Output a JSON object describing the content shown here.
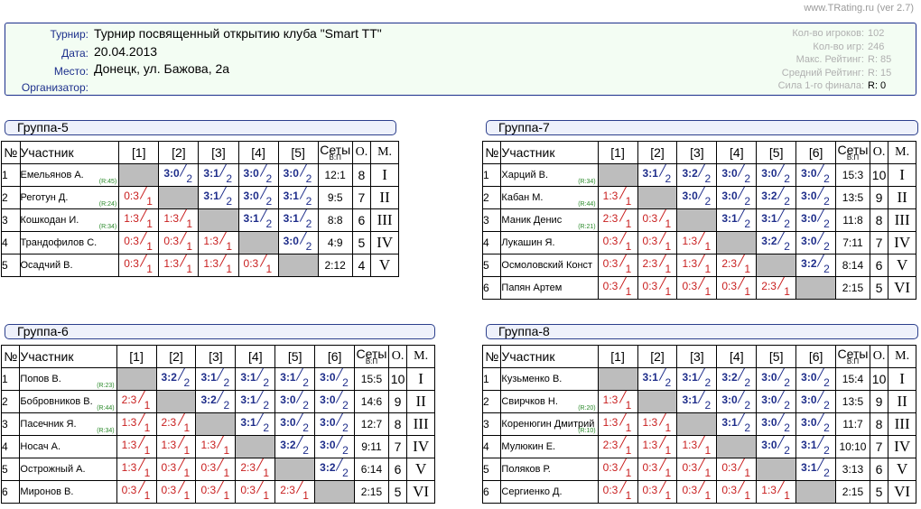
{
  "version": "www.TRating.ru (ver 2.7)",
  "tournament": {
    "labels": {
      "name": "Турнир:",
      "date": "Дата:",
      "place": "Место:",
      "organizer": "Организатор:"
    },
    "name": "Турнир посвященный открытию клуба \"Smart TT\"",
    "date": "20.04.2013",
    "place": "Донецк, ул. Бажова, 2а",
    "organizer": ""
  },
  "stats": [
    {
      "label": "Кол-во игроков:",
      "value": "102",
      "dark": false
    },
    {
      "label": "Кол-во игр:",
      "value": "246",
      "dark": false
    },
    {
      "label": "Макс. Рейтинг:",
      "value": "R:  85",
      "dark": false
    },
    {
      "label": "Средний Рейтинг:",
      "value": "R:  15",
      "dark": false
    },
    {
      "label": "Сила 1-го финала:",
      "value": "R:   0",
      "dark": true
    }
  ],
  "headers": {
    "num": "№",
    "player": "Участник",
    "sets": "Сеты",
    "sets_sub": "В:П",
    "points": "О.",
    "place": "М."
  },
  "groups": [
    {
      "title": "Группа-5",
      "players": [
        {
          "num": "1",
          "name": "Емельянов А.",
          "rating": "(R:45)",
          "results": [
            null,
            "3:0",
            "3:1",
            "3:0",
            "3:0"
          ],
          "sets": "12:1",
          "points": "8",
          "place": "I"
        },
        {
          "num": "2",
          "name": "Реготун Д.",
          "rating": "(R:24)",
          "results": [
            "0:3",
            null,
            "3:1",
            "3:0",
            "3:1"
          ],
          "sets": "9:5",
          "points": "7",
          "place": "II"
        },
        {
          "num": "3",
          "name": "Кошкодан И.",
          "rating": "(R:34)",
          "results": [
            "1:3",
            "1:3",
            null,
            "3:1",
            "3:1"
          ],
          "sets": "8:8",
          "points": "6",
          "place": "III"
        },
        {
          "num": "4",
          "name": "Трандофилов С.",
          "rating": "",
          "results": [
            "0:3",
            "0:3",
            "1:3",
            null,
            "3:0"
          ],
          "sets": "4:9",
          "points": "5",
          "place": "IV"
        },
        {
          "num": "5",
          "name": "Осадчий В.",
          "rating": "",
          "results": [
            "0:3",
            "1:3",
            "1:3",
            "0:3",
            null
          ],
          "sets": "2:12",
          "points": "4",
          "place": "V"
        }
      ]
    },
    {
      "title": "Группа-7",
      "players": [
        {
          "num": "1",
          "name": "Харций В.",
          "rating": "(R:34)",
          "results": [
            null,
            "3:1",
            "3:2",
            "3:0",
            "3:0",
            "3:0"
          ],
          "sets": "15:3",
          "points": "10",
          "place": "I"
        },
        {
          "num": "2",
          "name": "Кабан М.",
          "rating": "(R:44)",
          "results": [
            "1:3",
            null,
            "3:0",
            "3:0",
            "3:2",
            "3:0"
          ],
          "sets": "13:5",
          "points": "9",
          "place": "II"
        },
        {
          "num": "3",
          "name": "Маник Денис",
          "rating": "(R:21)",
          "results": [
            "2:3",
            "0:3",
            null,
            "3:1",
            "3:1",
            "3:0"
          ],
          "sets": "11:8",
          "points": "8",
          "place": "III"
        },
        {
          "num": "4",
          "name": "Лукашин Я.",
          "rating": "",
          "results": [
            "0:3",
            "0:3",
            "1:3",
            null,
            "3:2",
            "3:0"
          ],
          "sets": "7:11",
          "points": "7",
          "place": "IV"
        },
        {
          "num": "5",
          "name": "Осмоловский Конст",
          "rating": "",
          "results": [
            "0:3",
            "2:3",
            "1:3",
            "2:3",
            null,
            "3:2"
          ],
          "sets": "8:14",
          "points": "6",
          "place": "V"
        },
        {
          "num": "6",
          "name": "Папян Артем",
          "rating": "",
          "results": [
            "0:3",
            "0:3",
            "0:3",
            "0:3",
            "2:3",
            null
          ],
          "sets": "2:15",
          "points": "5",
          "place": "VI"
        }
      ]
    },
    {
      "title": "Группа-6",
      "players": [
        {
          "num": "1",
          "name": "Попов В.",
          "rating": "(R:23)",
          "results": [
            null,
            "3:2",
            "3:1",
            "3:1",
            "3:1",
            "3:0"
          ],
          "sets": "15:5",
          "points": "10",
          "place": "I"
        },
        {
          "num": "2",
          "name": "Бобровников В.",
          "rating": "(R:44)",
          "results": [
            "2:3",
            null,
            "3:2",
            "3:1",
            "3:0",
            "3:0"
          ],
          "sets": "14:6",
          "points": "9",
          "place": "II"
        },
        {
          "num": "3",
          "name": "Пасечник Я.",
          "rating": "(R:34)",
          "results": [
            "1:3",
            "2:3",
            null,
            "3:1",
            "3:0",
            "3:0"
          ],
          "sets": "12:7",
          "points": "8",
          "place": "III"
        },
        {
          "num": "4",
          "name": "Носач А.",
          "rating": "",
          "results": [
            "1:3",
            "1:3",
            "1:3",
            null,
            "3:2",
            "3:0"
          ],
          "sets": "9:11",
          "points": "7",
          "place": "IV"
        },
        {
          "num": "5",
          "name": "Острожный А.",
          "rating": "",
          "results": [
            "1:3",
            "0:3",
            "0:3",
            "2:3",
            null,
            "3:2"
          ],
          "sets": "6:14",
          "points": "6",
          "place": "V"
        },
        {
          "num": "6",
          "name": "Миронов В.",
          "rating": "",
          "results": [
            "0:3",
            "0:3",
            "0:3",
            "0:3",
            "2:3",
            null
          ],
          "sets": "2:15",
          "points": "5",
          "place": "VI"
        }
      ]
    },
    {
      "title": "Группа-8",
      "players": [
        {
          "num": "1",
          "name": "Кузьменко В.",
          "rating": "",
          "results": [
            null,
            "3:1",
            "3:1",
            "3:2",
            "3:0",
            "3:0"
          ],
          "sets": "15:4",
          "points": "10",
          "place": "I"
        },
        {
          "num": "2",
          "name": "Свирчков Н.",
          "rating": "(R:20)",
          "results": [
            "1:3",
            null,
            "3:1",
            "3:0",
            "3:0",
            "3:0"
          ],
          "sets": "13:5",
          "points": "9",
          "place": "II"
        },
        {
          "num": "3",
          "name": "Коренюгин Дмитрий",
          "rating": "(R:10)",
          "results": [
            "1:3",
            "1:3",
            null,
            "3:1",
            "3:0",
            "3:0"
          ],
          "sets": "11:7",
          "points": "8",
          "place": "III"
        },
        {
          "num": "4",
          "name": "Мулюкин Е.",
          "rating": "",
          "results": [
            "2:3",
            "1:3",
            "1:3",
            null,
            "3:0",
            "3:1"
          ],
          "sets": "10:10",
          "points": "7",
          "place": "IV"
        },
        {
          "num": "5",
          "name": "Поляков Р.",
          "rating": "",
          "results": [
            "0:3",
            "0:3",
            "0:3",
            "0:3",
            null,
            "3:1"
          ],
          "sets": "3:13",
          "points": "6",
          "place": "V"
        },
        {
          "num": "6",
          "name": "Сергиенко Д.",
          "rating": "",
          "results": [
            "0:3",
            "0:3",
            "0:3",
            "0:3",
            "1:3",
            null
          ],
          "sets": "2:15",
          "points": "5",
          "place": "VI"
        }
      ]
    }
  ]
}
